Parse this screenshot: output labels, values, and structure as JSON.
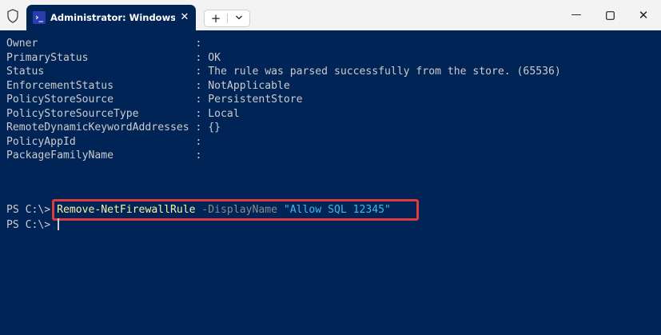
{
  "window": {
    "tab_title": "Administrator: Windows PowerShell",
    "tab_icon_glyph": "›_",
    "tab_close_glyph": "✕",
    "new_tab_glyph": "+",
    "dropdown_glyph": "⌄",
    "minimize_glyph": "—",
    "maximize_glyph": "▢",
    "close_glyph": "✕",
    "icons": [
      "shield-icon",
      "powershell-icon",
      "close-icon",
      "plus-icon",
      "chevron-down-icon",
      "minimize-icon",
      "maximize-icon",
      "close-icon"
    ]
  },
  "output": [
    {
      "key": "Owner                         ",
      "sep": ": ",
      "value": ""
    },
    {
      "key": "PrimaryStatus                 ",
      "sep": ": ",
      "value": "OK"
    },
    {
      "key": "Status                        ",
      "sep": ": ",
      "value": "The rule was parsed successfully from the store. (65536)"
    },
    {
      "key": "EnforcementStatus             ",
      "sep": ": ",
      "value": "NotApplicable"
    },
    {
      "key": "PolicyStoreSource             ",
      "sep": ": ",
      "value": "PersistentStore"
    },
    {
      "key": "PolicyStoreSourceType         ",
      "sep": ": ",
      "value": "Local"
    },
    {
      "key": "RemoteDynamicKeywordAddresses ",
      "sep": ": ",
      "value": "{}"
    },
    {
      "key": "PolicyAppId                   ",
      "sep": ": ",
      "value": ""
    },
    {
      "key": "PackageFamilyName             ",
      "sep": ": ",
      "value": ""
    }
  ],
  "command_line": {
    "prompt": "PS C:\\> ",
    "cmdlet": "Remove-NetFirewallRule",
    "parameter": " -DisplayName ",
    "argument": "\"Allow SQL 12345\""
  },
  "current_line": {
    "prompt": "PS C:\\> "
  },
  "colors": {
    "background": "#012456",
    "cmdlet": "#f9f1a5",
    "parameter": "#8a8a8a",
    "string": "#41b8e6",
    "highlight_box": "#e03a3e"
  }
}
